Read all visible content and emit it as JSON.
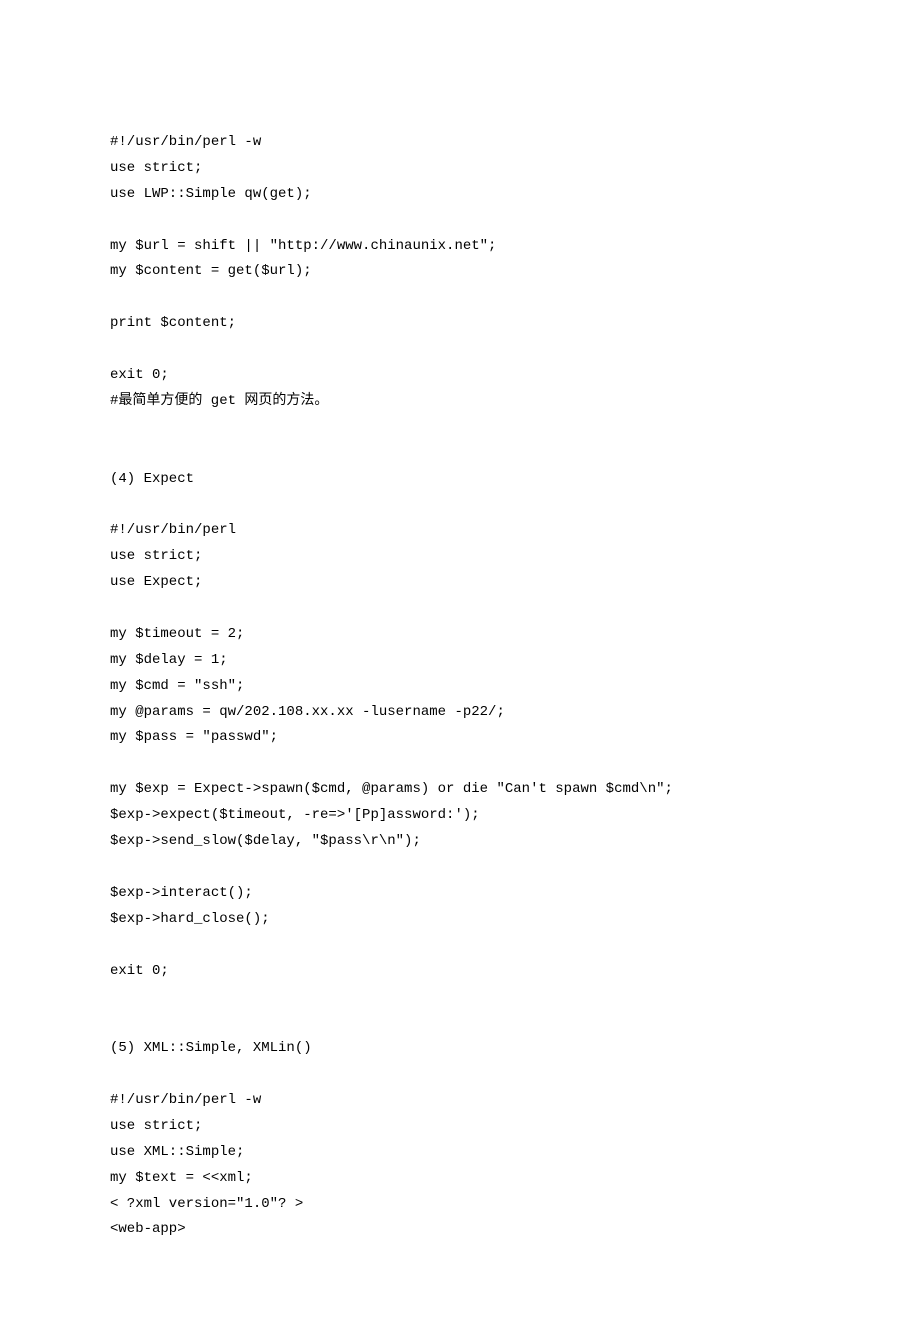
{
  "lines": [
    "#!/usr/bin/perl -w",
    "use strict;",
    "use LWP::Simple qw(get);",
    "",
    "my $url = shift || \"http://www.chinaunix.net\";",
    "my $content = get($url);",
    "",
    "print $content;",
    "",
    "exit 0;",
    "#最简单方便的 get 网页的方法。",
    "",
    "",
    "(4) Expect",
    "",
    "#!/usr/bin/perl",
    "use strict;",
    "use Expect;",
    "",
    "my $timeout = 2;",
    "my $delay = 1;",
    "my $cmd = \"ssh\";",
    "my @params = qw/202.108.xx.xx -lusername -p22/;",
    "my $pass = \"passwd\";",
    "",
    "my $exp = Expect->spawn($cmd, @params) or die \"Can't spawn $cmd\\n\";",
    "$exp->expect($timeout, -re=>'[Pp]assword:');",
    "$exp->send_slow($delay, \"$pass\\r\\n\");",
    "",
    "$exp->interact();",
    "$exp->hard_close();",
    "",
    "exit 0;",
    "",
    "",
    "(5) XML::Simple, XMLin()",
    "",
    "#!/usr/bin/perl -w",
    "use strict;",
    "use XML::Simple;",
    "my $text = <<xml;",
    "< ?xml version=\"1.0\"? >",
    "<web-app>"
  ]
}
